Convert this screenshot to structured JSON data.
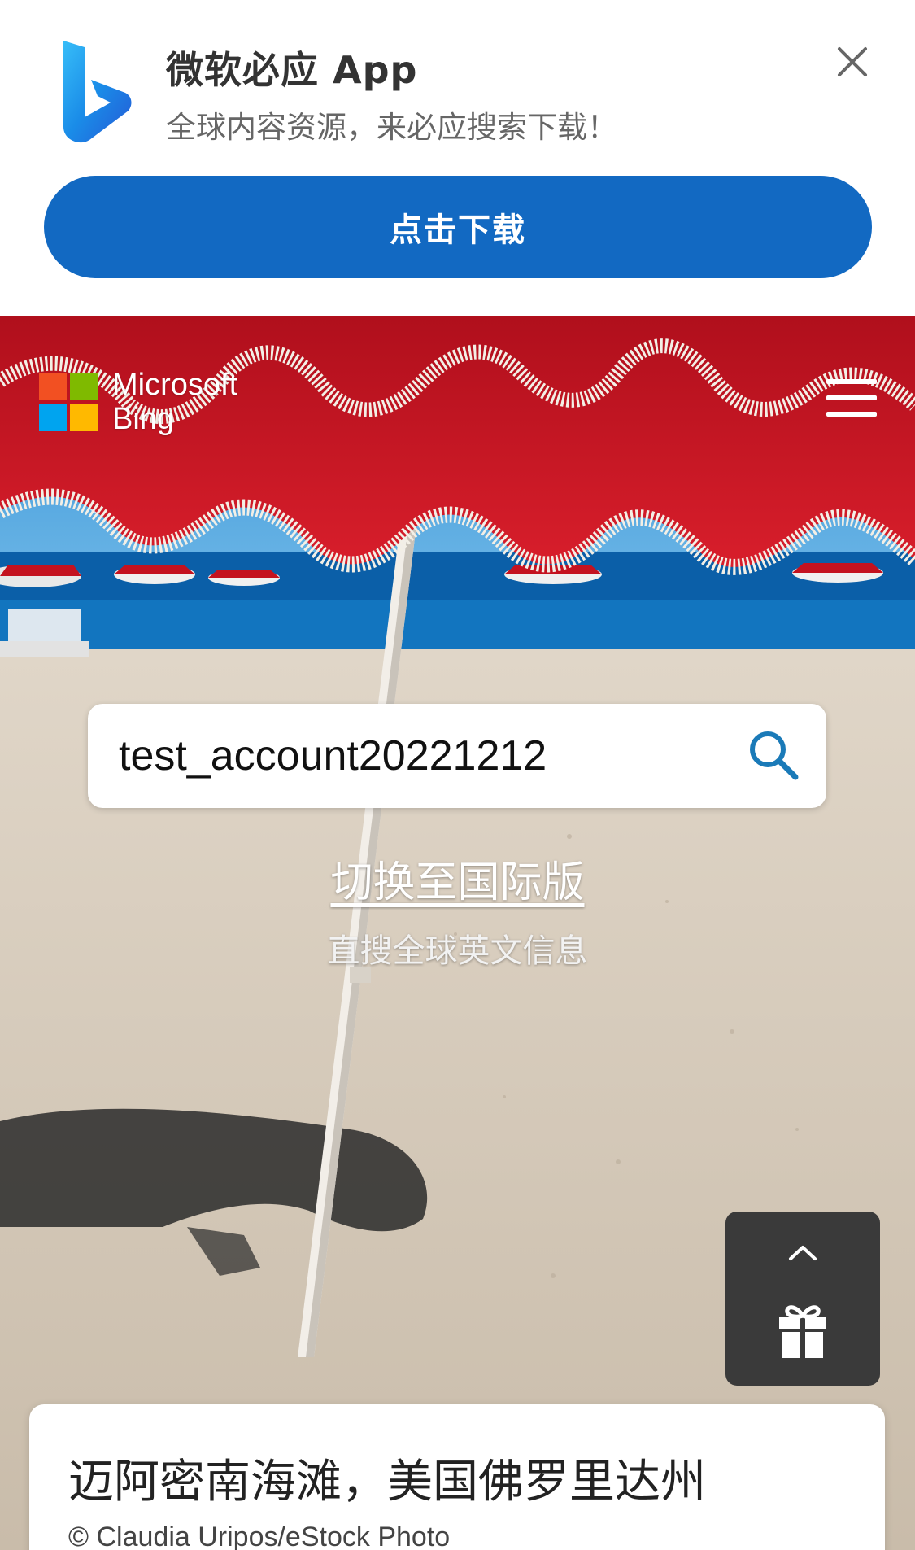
{
  "promo": {
    "title": "微软必应 App",
    "subtitle": "全球内容资源，来必应搜索下载！",
    "download_label": "点击下载",
    "close_icon": "close-icon",
    "logo_icon": "bing-b-logo"
  },
  "header": {
    "brand_line1": "Microsoft",
    "brand_line2": "Bing",
    "logo_colors": [
      "#f25022",
      "#7fba00",
      "#00a4ef",
      "#ffb900"
    ],
    "menu_icon": "hamburger-menu-icon"
  },
  "search": {
    "value": "test_account20221212",
    "icon": "search-icon",
    "icon_color": "#1a7ab8"
  },
  "international": {
    "link_label": "切换至国际版",
    "subtitle": "直搜全球英文信息"
  },
  "float_panel": {
    "up_icon": "chevron-up-icon",
    "gift_icon": "gift-icon"
  },
  "caption": {
    "title": "迈阿密南海滩，美国佛罗里达州",
    "credit": "© Claudia Uripos/eStock Photo"
  },
  "colors": {
    "promo_button": "#1269c2",
    "umbrella_red": "#c4121f",
    "sky": "#4a9ed6",
    "sea": "#0b5fa8",
    "sand": "#d4c9bb"
  }
}
